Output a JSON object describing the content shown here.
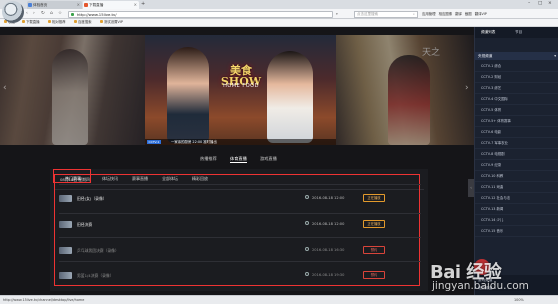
{
  "browser": {
    "tabs": [
      {
        "label": "体验首页"
      },
      {
        "label": "下载直播"
      }
    ],
    "new_tab": "+",
    "url": "http://www.15live.tv/",
    "search_placeholder": "点击这里搜索",
    "ext_buttons": [
      "应用管理",
      "相应图像",
      "翻译",
      "截图",
      "翻译VIP"
    ],
    "bookmarks": [
      "收藏",
      "下载直播",
      "相对推荐",
      "百度搜索",
      "测试设置VIP"
    ]
  },
  "hero": {
    "caption_channel": "CCTV-1",
    "caption": "一家亲的厨房 22:00 准时播出",
    "show_logo": "美食SHOW",
    "show_sub": "HOME FOOD",
    "right_calligraphy": "天之"
  },
  "section_tabs": [
    {
      "label": "热播推荐",
      "active": false
    },
    {
      "label": "体育直播",
      "active": true
    },
    {
      "label": "游戏直播",
      "active": false
    }
  ],
  "subtabs": [
    {
      "label": "热门赛事",
      "active": true
    },
    {
      "label": "体坛快讯",
      "active": false
    },
    {
      "label": "赛事直播",
      "active": false
    },
    {
      "label": "全部体坛",
      "active": false
    },
    {
      "label": "精彩回放",
      "active": false
    }
  ],
  "schedule": {
    "date": "08月18日 星期四",
    "rows": [
      {
        "title": "田径(女)（录像）",
        "time": "2016-08-18 12:00",
        "button": "正在播放",
        "booked": false
      },
      {
        "title": "田径决赛",
        "time": "2016-08-18 12:00",
        "button": "正在播放",
        "booked": false
      },
      {
        "title": "乒乓球男团决赛（录像）",
        "time": "2016-08-18 16:30",
        "button": "预约",
        "booked": true
      },
      {
        "title": "男篮1/4决赛（录像）",
        "time": "2016-08-18 19:30",
        "button": "预约",
        "booked": true
      }
    ]
  },
  "sidebar": {
    "top_tabs": [
      "频道列表",
      "节目"
    ],
    "section": "央视频道",
    "channels": [
      "CCTV-1 综合",
      "CCTV-2 财经",
      "CCTV-3 综艺",
      "CCTV-4 中文国际",
      "CCTV-5 体育",
      "CCTV-5+ 体育赛事",
      "CCTV-6 电影",
      "CCTV-7 军事农业",
      "CCTV-8 电视剧",
      "CCTV-9 纪录",
      "CCTV-10 科教",
      "CCTV-11 戏曲",
      "CCTV-12 社会与法",
      "CCTV-13 新闻",
      "CCTV-14 少儿",
      "CCTV-15 音乐"
    ],
    "bottom": [
      "游戏频道",
      "地方频道"
    ]
  },
  "statusbar": {
    "url": "http://www.15live.tv/channel/desktop/live/home",
    "zoom": "100%"
  },
  "watermark": {
    "baidu": "Bai 经验",
    "site": "jingyan.baidu.com"
  }
}
